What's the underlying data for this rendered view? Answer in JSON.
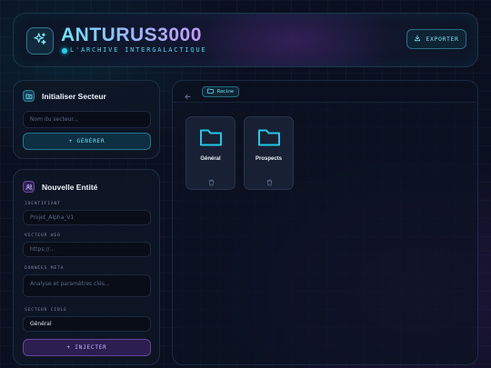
{
  "header": {
    "title": "ANTURUS3000",
    "subtitle": "L'ARCHIVE INTERGALACTIQUE",
    "export_label": "EXPORTER",
    "logo_icon": "sparkles-icon"
  },
  "sector_panel": {
    "title": "Initialiser Secteur",
    "icon": "folder-plus-icon",
    "name_placeholder": "Nom du secteur...",
    "generate_label": "+ GÉNÉRER"
  },
  "entity_panel": {
    "title": "Nouvelle Entité",
    "icon": "users-icon",
    "identifier_label": "IDENTIFIANT",
    "identifier_placeholder": "Projet_Alpha_V1",
    "web_label": "VECTEUR WEB",
    "web_placeholder": "https://...",
    "meta_label": "DONNÉES META",
    "meta_placeholder": "Analyse et paramètres clés...",
    "target_label": "SECTEUR CIBLE",
    "target_value": "Général",
    "inject_label": "+ INJECTER"
  },
  "explorer": {
    "back_icon": "arrow-left-icon",
    "breadcrumb": "Racine",
    "folders": [
      {
        "name": "Général"
      },
      {
        "name": "Prospects"
      }
    ]
  },
  "colors": {
    "accent_cyan": "#22d3ee",
    "accent_purple": "#a78bfa",
    "background": "#0b1020"
  }
}
